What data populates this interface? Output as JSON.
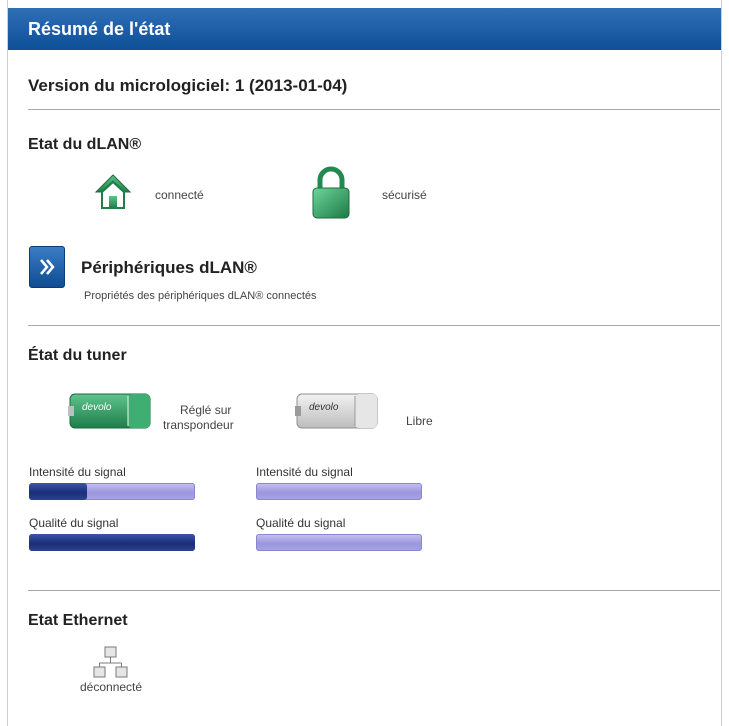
{
  "header": {
    "title": "Résumé de l'état"
  },
  "firmware": {
    "label": "Version du micrologiciel: 1 (2013-01-04)"
  },
  "dlan": {
    "title": "Etat du dLAN®",
    "connection_status": "connecté",
    "security_status": "sécurisé",
    "devices_link_title": "Périphériques dLAN®",
    "devices_link_subtitle": "Propriétés des périphériques dLAN® connectés"
  },
  "tuner": {
    "title": "État du tuner",
    "tuners": [
      {
        "status_line1": "Réglé sur",
        "status_line2": "transpondeur",
        "brand": "devolo",
        "signal_label": "Intensité du signal",
        "signal_level": 0.35,
        "quality_label": "Qualité du signal",
        "quality_level": 1.0
      },
      {
        "status_line1": "Libre",
        "brand": "devolo",
        "signal_label": "Intensité du signal",
        "signal_level": 0.0,
        "quality_label": "Qualité du signal",
        "quality_level": 0.0
      }
    ]
  },
  "ethernet": {
    "title": "Etat Ethernet",
    "status": "déconnecté"
  },
  "colors": {
    "header_blue": "#0d4f98",
    "house_green": "#2e9a5b",
    "bar_fill": "#1a2e7a",
    "bar_empty": "#9c97dd"
  }
}
